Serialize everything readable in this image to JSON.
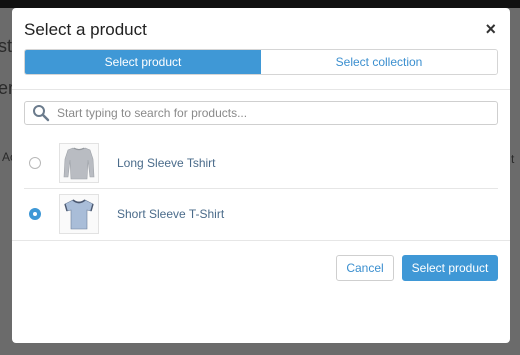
{
  "background": {
    "partial_texts": [
      "st",
      "er",
      "Ac",
      "t"
    ]
  },
  "modal": {
    "title": "Select a product",
    "close_glyph": "×",
    "tabs": [
      {
        "label": "Select product",
        "active": true
      },
      {
        "label": "Select collection",
        "active": false
      }
    ],
    "search": {
      "placeholder": "Start typing to search for products...",
      "value": "",
      "icon": "search-icon"
    },
    "products": [
      {
        "name": "Long Sleeve Tshirt",
        "selected": false,
        "thumb_icon": "long-sleeve-shirt-icon"
      },
      {
        "name": "Short Sleeve T-Shirt",
        "selected": true,
        "thumb_icon": "short-sleeve-shirt-icon"
      }
    ],
    "footer": {
      "cancel_label": "Cancel",
      "submit_label": "Select product"
    }
  },
  "colors": {
    "accent": "#3f98d6",
    "overlay": "#5f5f5f"
  }
}
